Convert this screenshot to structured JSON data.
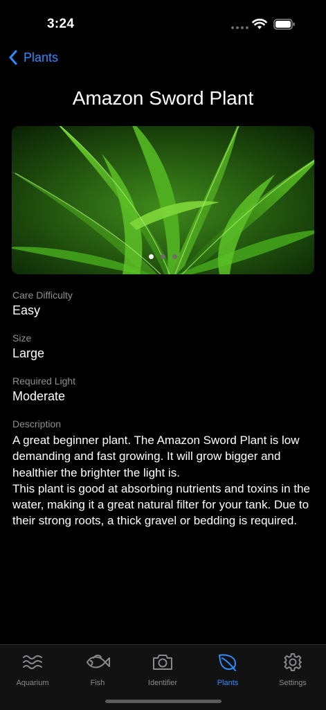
{
  "status": {
    "time": "3:24"
  },
  "nav": {
    "back_label": "Plants"
  },
  "page": {
    "title": "Amazon Sword Plant"
  },
  "carousel": {
    "page_count": 3,
    "current_page": 1,
    "active_dot_color": "#ffffff",
    "inactive_dot_color": "#6e6e6e"
  },
  "fields": {
    "difficulty": {
      "label": "Care Difficulty",
      "value": "Easy"
    },
    "size": {
      "label": "Size",
      "value": "Large"
    },
    "light": {
      "label": "Required Light",
      "value": "Moderate"
    },
    "description": {
      "label": "Description",
      "value": "A great beginner plant. The Amazon Sword Plant is low demanding and fast growing. It will grow bigger and healthier the brighter the light is.\nThis plant is good at absorbing nutrients and toxins in the water, making it a great natural filter for your tank. Due to their strong roots, a thick gravel or bedding is required."
    }
  },
  "tabs": [
    {
      "label": "Aquarium",
      "icon": "waves-icon",
      "active": false
    },
    {
      "label": "Fish",
      "icon": "fish-icon",
      "active": false
    },
    {
      "label": "Identifier",
      "icon": "camera-icon",
      "active": false
    },
    {
      "label": "Plants",
      "icon": "leaf-icon",
      "active": true
    },
    {
      "label": "Settings",
      "icon": "gear-icon",
      "active": false
    }
  ],
  "colors": {
    "accent": "#2f8cff",
    "tab_inactive": "#8a8a8e",
    "background": "#000000"
  }
}
